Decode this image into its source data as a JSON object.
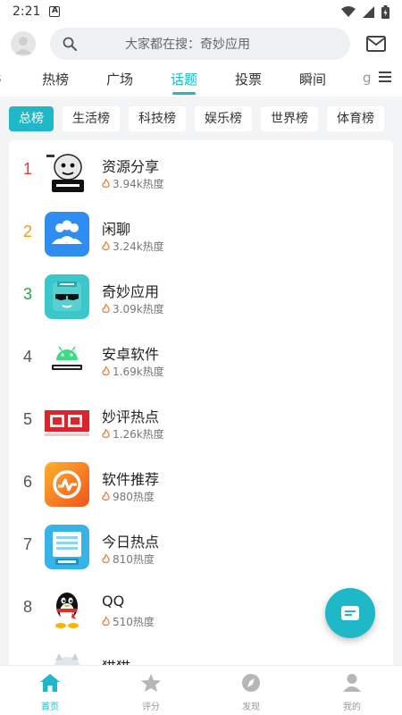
{
  "status_bar": {
    "time": "2:21"
  },
  "search": {
    "placeholder": "大家都在搜：奇妙应用"
  },
  "tabs": [
    {
      "label": "热榜"
    },
    {
      "label": "广场"
    },
    {
      "label": "话题",
      "active": true
    },
    {
      "label": "投票"
    },
    {
      "label": "瞬间"
    }
  ],
  "chips": [
    {
      "label": "总榜",
      "active": true
    },
    {
      "label": "生活榜"
    },
    {
      "label": "科技榜"
    },
    {
      "label": "娱乐榜"
    },
    {
      "label": "世界榜"
    },
    {
      "label": "体育榜"
    }
  ],
  "topics": [
    {
      "rank": "1",
      "name": "资源分享",
      "heat": "3.94k热度",
      "icon": "meme-avatar",
      "rank_color": "#e03a3a"
    },
    {
      "rank": "2",
      "name": "闲聊",
      "heat": "3.24k热度",
      "icon": "chat-group",
      "rank_color": "#f39c12"
    },
    {
      "rank": "3",
      "name": "奇妙应用",
      "heat": "3.09k热度",
      "icon": "magic-cool",
      "rank_color": "#27a845"
    },
    {
      "rank": "4",
      "name": "安卓软件",
      "heat": "1.69k热度",
      "icon": "android",
      "rank_color": "#555555"
    },
    {
      "rank": "5",
      "name": "妙评热点",
      "heat": "1.26k热度",
      "icon": "hot-news",
      "rank_color": "#555555"
    },
    {
      "rank": "6",
      "name": "软件推荐",
      "heat": "980热度",
      "icon": "software",
      "rank_color": "#555555"
    },
    {
      "rank": "7",
      "name": "今日热点",
      "heat": "810热度",
      "icon": "news",
      "rank_color": "#555555"
    },
    {
      "rank": "8",
      "name": "QQ",
      "heat": "510热度",
      "icon": "qq",
      "rank_color": "#555555"
    },
    {
      "rank": "",
      "name": "猫猫",
      "heat": "",
      "icon": "cat",
      "rank_color": "#555555"
    }
  ],
  "bottom_nav": [
    {
      "label": "首页",
      "active": true
    },
    {
      "label": "评分"
    },
    {
      "label": "发现"
    },
    {
      "label": "我的"
    }
  ],
  "colors": {
    "accent": "#1fb8c8"
  }
}
